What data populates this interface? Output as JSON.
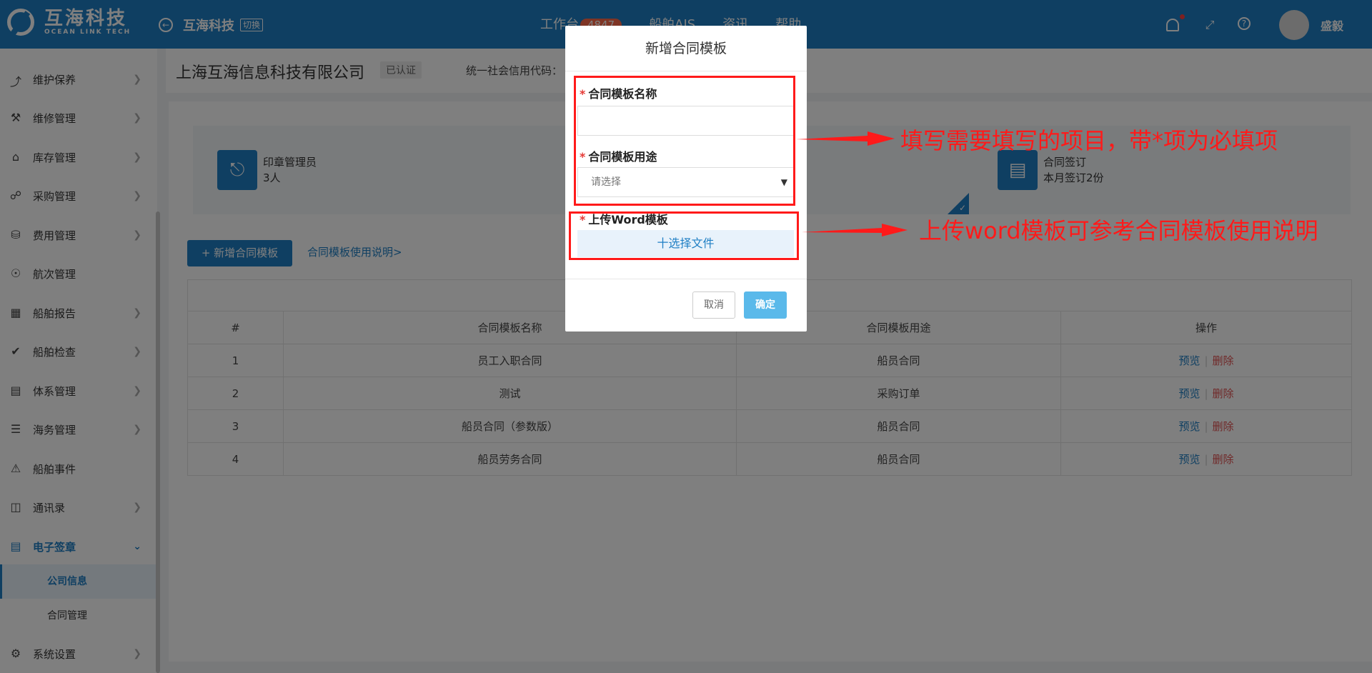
{
  "header": {
    "logo_cn": "互海科技",
    "logo_en": "OCEAN LINK TECH",
    "company": "互海科技",
    "switch_label": "切换",
    "nav": [
      {
        "label": "工作台",
        "badge": "4847"
      },
      {
        "label": "船舶AIS"
      },
      {
        "label": "资讯"
      },
      {
        "label": "帮助"
      }
    ],
    "user_name": "盛毅"
  },
  "sidebar": {
    "items": [
      {
        "label": "维护保养",
        "icon": "pin-icon"
      },
      {
        "label": "维修管理",
        "icon": "wrench-icon"
      },
      {
        "label": "库存管理",
        "icon": "home-icon"
      },
      {
        "label": "采购管理",
        "icon": "cart-icon"
      },
      {
        "label": "费用管理",
        "icon": "coins-icon"
      },
      {
        "label": "航次管理",
        "icon": "globe-icon"
      },
      {
        "label": "船舶报告",
        "icon": "calendar-icon"
      },
      {
        "label": "船舶检查",
        "icon": "check-circle-icon"
      },
      {
        "label": "体系管理",
        "icon": "document-icon"
      },
      {
        "label": "海务管理",
        "icon": "signpost-icon"
      },
      {
        "label": "船舶事件",
        "icon": "warning-icon"
      },
      {
        "label": "通讯录",
        "icon": "contacts-icon"
      },
      {
        "label": "电子签章",
        "icon": "document-icon"
      },
      {
        "label": "系统设置",
        "icon": "gear-icon"
      }
    ],
    "sub_items": [
      "公司信息",
      "合同管理"
    ]
  },
  "company_bar": {
    "name": "上海互海信息科技有限公司",
    "status": "已认证",
    "credit_label": "统一社会信用代码："
  },
  "stats": [
    {
      "title": "印章管理员",
      "value": "3人",
      "icon": "stamp-icon"
    },
    {
      "title": "合同签订",
      "value": "本月签订2份",
      "icon": "contract-icon"
    }
  ],
  "toolbar": {
    "add_button": "+ 新增合同模板",
    "guide_link": "合同模板使用说明>"
  },
  "table": {
    "columns": [
      "#",
      "合同模板名称",
      "合同模板用途",
      "操作"
    ],
    "rows": [
      {
        "no": "1",
        "name": "员工入职合同",
        "purpose": "船员合同"
      },
      {
        "no": "2",
        "name": "测试",
        "purpose": "采购订单"
      },
      {
        "no": "3",
        "name": "船员合同（参数版）",
        "purpose": "船员合同"
      },
      {
        "no": "4",
        "name": "船员劳务合同",
        "purpose": "船员合同"
      }
    ],
    "action_view": "预览",
    "action_delete": "删除"
  },
  "modal": {
    "title": "新增合同模板",
    "required_mark": "*",
    "name_label": "合同模板名称",
    "name_value": "",
    "purpose_label": "合同模板用途",
    "purpose_placeholder": "请选择",
    "upload_label": "上传Word模板",
    "file_button": "十选择文件",
    "cancel": "取消",
    "confirm": "确定"
  },
  "annotations": {
    "note1": "填写需要填写的项目，带*项为必填项",
    "note2": "上传word模板可参考合同模板使用说明"
  },
  "colors": {
    "primary": "#1f7fc4",
    "annotation": "#ff1a1a",
    "danger": "#e05050"
  }
}
